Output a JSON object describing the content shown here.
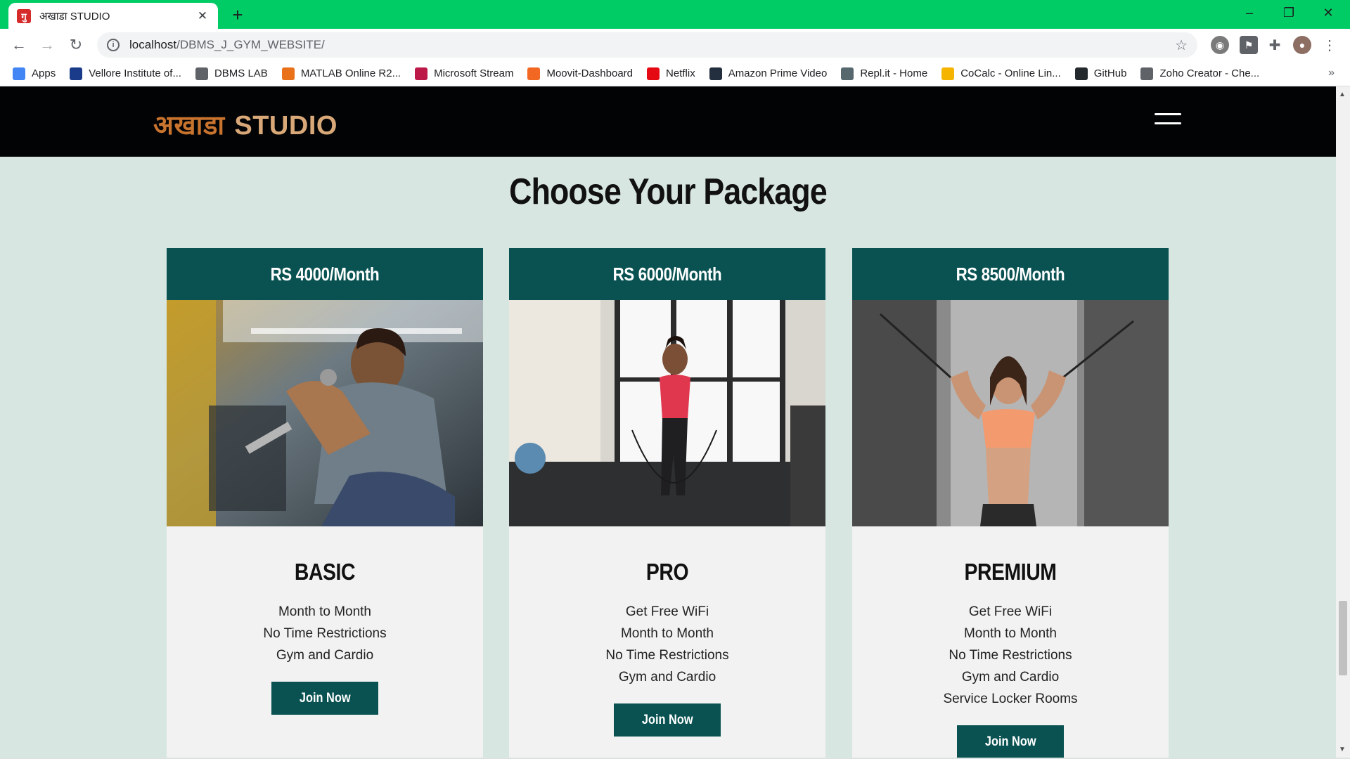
{
  "browser": {
    "tab_title": "अखाडा STUDIO",
    "tab_favicon": "गु",
    "url_host": "localhost",
    "url_path": "/DBMS_J_GYM_WEBSITE/",
    "bookmarks": [
      {
        "label": "Apps",
        "icon": "apps-grid-icon",
        "color": "#4285f4"
      },
      {
        "label": "Vellore Institute of...",
        "icon": "vit-icon",
        "color": "#1a3a8a"
      },
      {
        "label": "DBMS LAB",
        "icon": "globe-icon",
        "color": "#5f6368"
      },
      {
        "label": "MATLAB Online R2...",
        "icon": "matlab-icon",
        "color": "#e8711a"
      },
      {
        "label": "Microsoft Stream",
        "icon": "stream-icon",
        "color": "#bc1948"
      },
      {
        "label": "Moovit-Dashboard",
        "icon": "moovit-icon",
        "color": "#f26722"
      },
      {
        "label": "Netflix",
        "icon": "netflix-icon",
        "color": "#e50914"
      },
      {
        "label": "Amazon Prime Video",
        "icon": "amazon-icon",
        "color": "#232f3e"
      },
      {
        "label": "Repl.it - Home",
        "icon": "replit-icon",
        "color": "#56676e"
      },
      {
        "label": "CoCalc - Online Lin...",
        "icon": "cocalc-icon",
        "color": "#f4b400"
      },
      {
        "label": "GitHub",
        "icon": "github-icon",
        "color": "#24292e"
      },
      {
        "label": "Zoho Creator - Che...",
        "icon": "globe-icon",
        "color": "#5f6368"
      }
    ]
  },
  "site": {
    "logo_devanagari": "अखाडा",
    "logo_studio": "STUDIO",
    "section_title": "Choose Your Package",
    "packages": [
      {
        "price": "RS 4000/Month",
        "name": "BASIC",
        "features": [
          "Month to Month",
          "No Time Restrictions",
          "Gym and Cardio"
        ],
        "cta": "Join Now"
      },
      {
        "price": "RS 6000/Month",
        "name": "PRO",
        "features": [
          "Get Free WiFi",
          "Month to Month",
          "No Time Restrictions",
          "Gym and Cardio"
        ],
        "cta": "Join Now"
      },
      {
        "price": "RS 8500/Month",
        "name": "PREMIUM",
        "features": [
          "Get Free WiFi",
          "Month to Month",
          "No Time Restrictions",
          "Gym and Cardio",
          "Service Locker Rooms"
        ],
        "cta": "Join Now"
      }
    ]
  },
  "colors": {
    "titlebar": "#00cc66",
    "header_bg": "#020305",
    "logo_accent": "#c8732e",
    "card_header": "#0a5252",
    "page_bg": "#d8e6e2"
  }
}
